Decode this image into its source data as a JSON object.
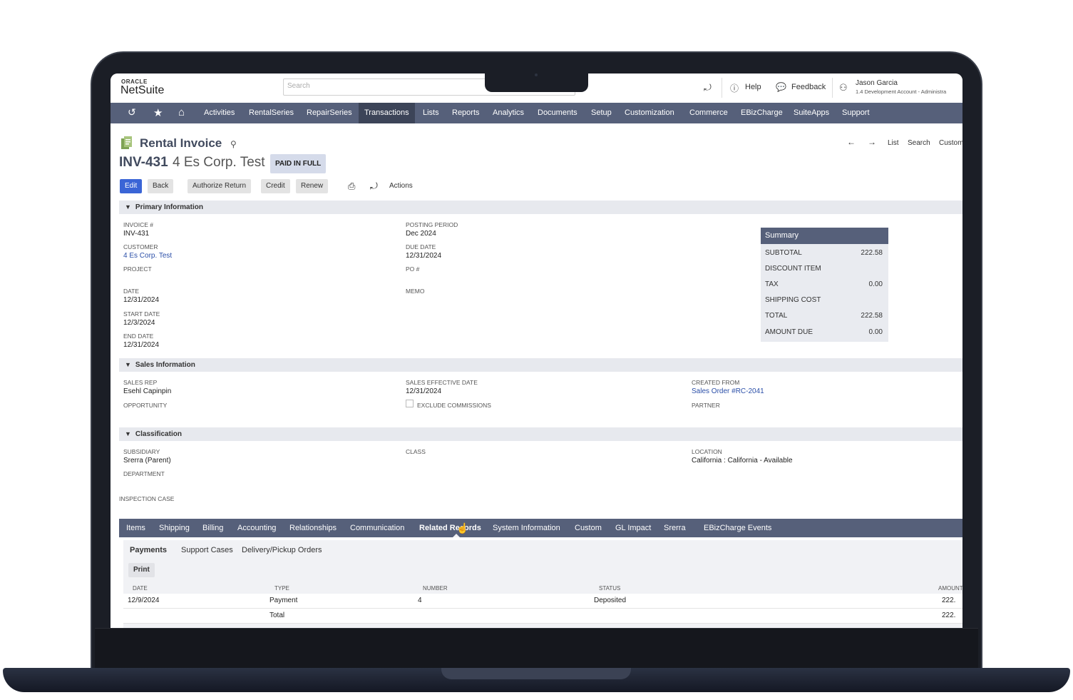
{
  "header": {
    "logo_top": "ORACLE",
    "logo_main": "NetSuite",
    "search_placeholder": "Search",
    "help": "Help",
    "feedback": "Feedback",
    "user_name": "Jason Garcia",
    "user_role": "1.4 Development Account - Administra"
  },
  "nav": {
    "items": [
      "Activities",
      "RentalSeries",
      "RepairSeries",
      "Transactions",
      "Lists",
      "Reports",
      "Analytics",
      "Documents",
      "Setup",
      "Customization",
      "Commerce",
      "EBizCharge",
      "SuiteApps",
      "Support"
    ],
    "active": "Transactions"
  },
  "record": {
    "type": "Rental Invoice",
    "id": "INV-431",
    "name": "4 Es Corp. Test",
    "status": "PAID IN FULL",
    "pager": {
      "list": "List",
      "search": "Search",
      "customize": "Custom"
    }
  },
  "buttons": {
    "edit": "Edit",
    "back": "Back",
    "authorize_return": "Authorize Return",
    "credit": "Credit",
    "renew": "Renew",
    "actions": "Actions"
  },
  "primary": {
    "title": "Primary Information",
    "invoice_label": "INVOICE #",
    "invoice_value": "INV-431",
    "customer_label": "CUSTOMER",
    "customer_value": "4 Es Corp. Test",
    "project_label": "PROJECT",
    "date_label": "DATE",
    "date_value": "12/31/2024",
    "start_label": "START DATE",
    "start_value": "12/3/2024",
    "end_label": "END DATE",
    "end_value": "12/31/2024",
    "period_label": "POSTING PERIOD",
    "period_value": "Dec 2024",
    "due_label": "DUE DATE",
    "due_value": "12/31/2024",
    "po_label": "PO #",
    "memo_label": "MEMO"
  },
  "summary": {
    "title": "Summary",
    "subtotal_label": "SUBTOTAL",
    "subtotal_value": "222.58",
    "discount_label": "DISCOUNT ITEM",
    "tax_label": "TAX",
    "tax_value": "0.00",
    "shipping_label": "SHIPPING COST",
    "total_label": "TOTAL",
    "total_value": "222.58",
    "due_label": "AMOUNT DUE",
    "due_value": "0.00"
  },
  "sales": {
    "title": "Sales Information",
    "rep_label": "SALES REP",
    "rep_value": "Esehl Capinpin",
    "opportunity_label": "OPPORTUNITY",
    "effective_label": "SALES EFFECTIVE DATE",
    "effective_value": "12/31/2024",
    "exclude_label": "EXCLUDE COMMISSIONS",
    "created_label": "CREATED FROM",
    "created_value": "Sales Order #RC-2041",
    "partner_label": "PARTNER"
  },
  "classification": {
    "title": "Classification",
    "subsidiary_label": "SUBSIDIARY",
    "subsidiary_value": "Srerra (Parent)",
    "department_label": "DEPARTMENT",
    "class_label": "CLASS",
    "location_label": "LOCATION",
    "location_value": "California : California - Available",
    "inspection_label": "INSPECTION CASE"
  },
  "subtabs": {
    "items": [
      "Items",
      "Shipping",
      "Billing",
      "Accounting",
      "Relationships",
      "Communication",
      "Related Records",
      "System Information",
      "Custom",
      "GL Impact",
      "Srerra",
      "EBizCharge Events"
    ],
    "active": "Related Records"
  },
  "related": {
    "tabs": [
      "Payments",
      "Support Cases",
      "Delivery/Pickup Orders"
    ],
    "active_tab": "Payments",
    "print": "Print",
    "columns": [
      "DATE",
      "TYPE",
      "NUMBER",
      "STATUS",
      "AMOUNT"
    ],
    "rows": [
      {
        "date": "12/9/2024",
        "type": "Payment",
        "number": "4",
        "status": "Deposited",
        "amount": "222."
      },
      {
        "date": "",
        "type": "Total",
        "number": "",
        "status": "",
        "amount": "222."
      }
    ]
  }
}
